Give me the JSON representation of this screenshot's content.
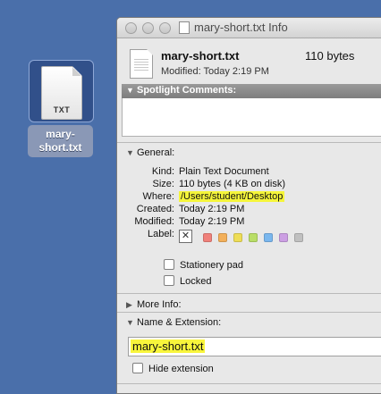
{
  "desktop": {
    "file_icon": "text-document-icon",
    "file_badge": "TXT",
    "file_label_line1": "mary-",
    "file_label_line2": "short.txt"
  },
  "window": {
    "title": "mary-short.txt Info",
    "file_name": "mary-short.txt",
    "file_size": "110 bytes",
    "modified_summary": "Modified: Today 2:19 PM"
  },
  "spotlight": {
    "title": "Spotlight Comments:",
    "value": ""
  },
  "general": {
    "title": "General:",
    "rows": {
      "kind_label": "Kind:",
      "kind_value": "Plain Text Document",
      "size_label": "Size:",
      "size_value": "110 bytes (4 KB on disk)",
      "where_label": "Where:",
      "where_value": "/Users/student/Desktop",
      "created_label": "Created:",
      "created_value": "Today 2:19 PM",
      "modified_label": "Modified:",
      "modified_value": "Today 2:19 PM",
      "label_label": "Label:"
    },
    "label_colors": [
      "#f0817b",
      "#f3b05a",
      "#eedd56",
      "#b9de67",
      "#7ab7ee",
      "#cc9fe3",
      "#c0c0c0"
    ],
    "stationery_label": "Stationery pad",
    "locked_label": "Locked"
  },
  "more_info": {
    "title": "More Info:"
  },
  "name_ext": {
    "title": "Name & Extension:",
    "value": "mary-short.txt",
    "hide_ext_label": "Hide extension"
  }
}
